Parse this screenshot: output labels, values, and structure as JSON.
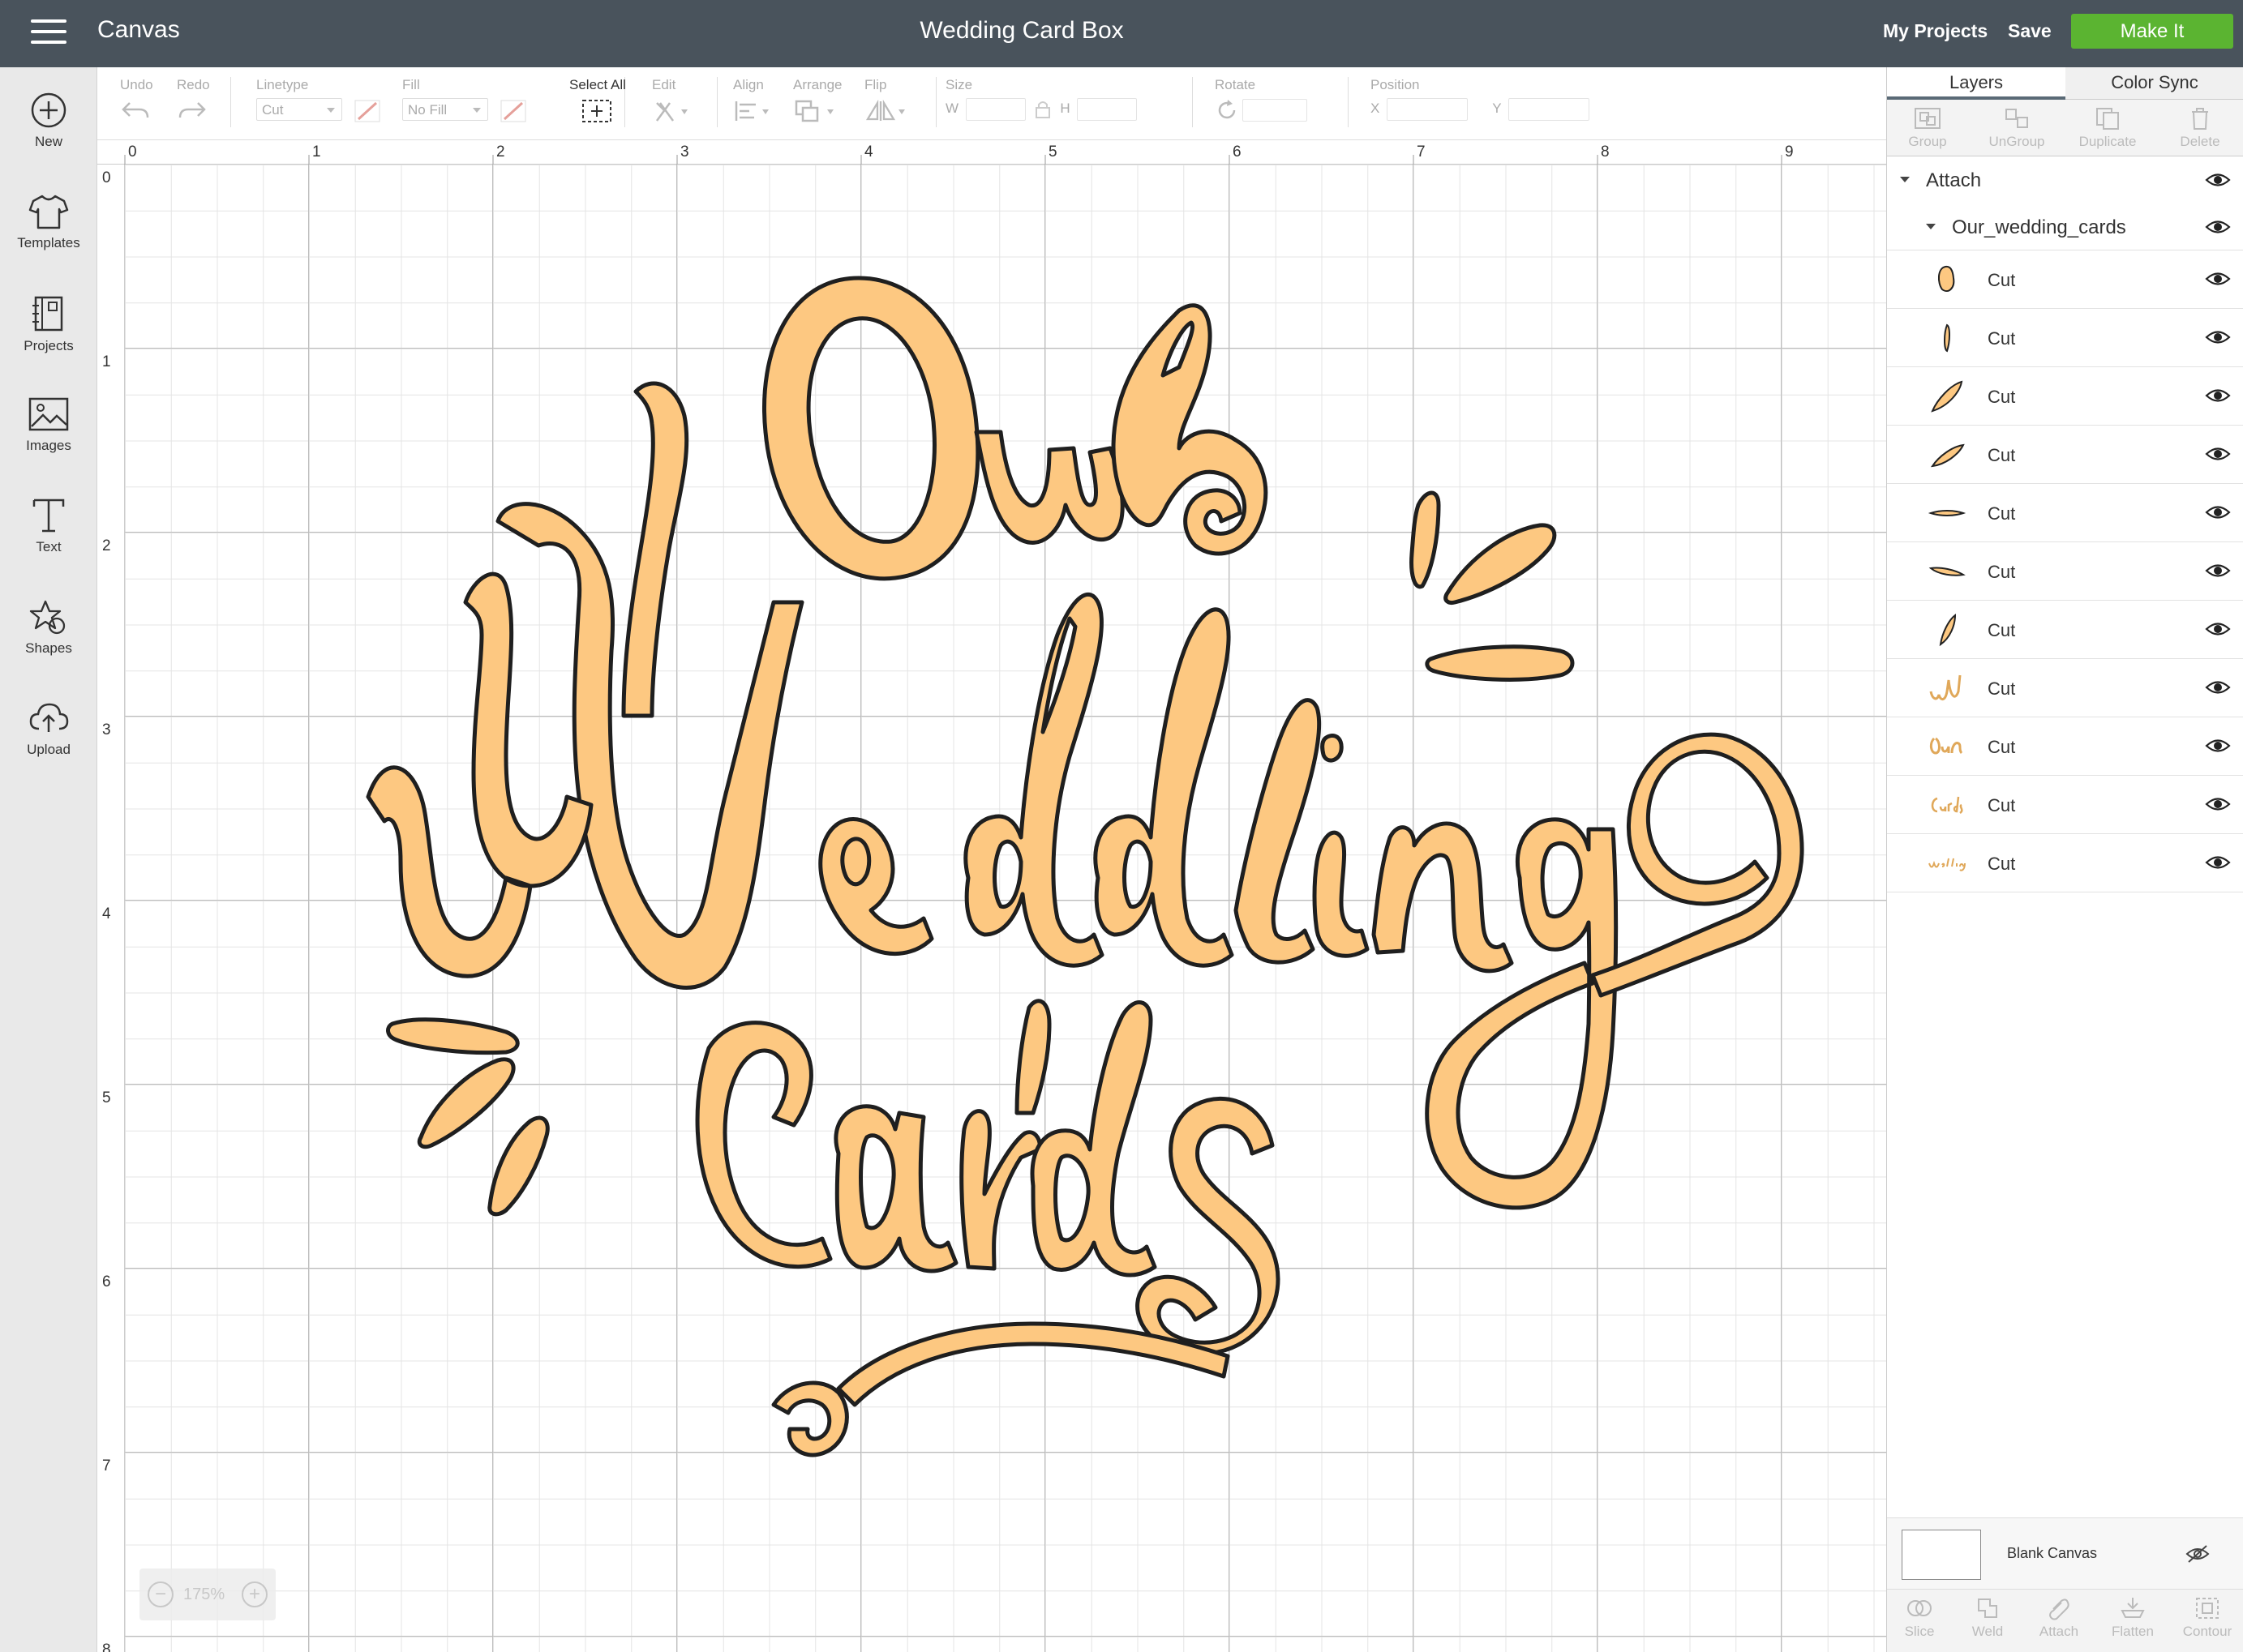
{
  "app": {
    "menu_icon": "hamburger-icon",
    "title": "Canvas",
    "document_title": "Wedding Card Box"
  },
  "header": {
    "my_projects": "My Projects",
    "save": "Save",
    "make_it": "Make It",
    "make_it_color": "#5bb431",
    "bar_color": "#49535c"
  },
  "sidebar": {
    "items": [
      {
        "label": "New",
        "icon": "plus-circle-icon"
      },
      {
        "label": "Templates",
        "icon": "tshirt-icon"
      },
      {
        "label": "Projects",
        "icon": "notebook-icon"
      },
      {
        "label": "Images",
        "icon": "image-icon"
      },
      {
        "label": "Text",
        "icon": "text-t-icon"
      },
      {
        "label": "Shapes",
        "icon": "shapes-icon"
      },
      {
        "label": "Upload",
        "icon": "cloud-upload-icon"
      }
    ]
  },
  "toolbar": {
    "undo": "Undo",
    "redo": "Redo",
    "linetype_label": "Linetype",
    "linetype_value": "Cut",
    "fill_label": "Fill",
    "fill_value": "No Fill",
    "select_all": "Select All",
    "edit": "Edit",
    "align": "Align",
    "arrange": "Arrange",
    "flip": "Flip",
    "size": "Size",
    "size_w": "W",
    "size_h": "H",
    "rotate": "Rotate",
    "position": "Position",
    "pos_x": "X",
    "pos_y": "Y"
  },
  "rulers": {
    "horizontal": [
      "0",
      "1",
      "2",
      "3",
      "4",
      "5",
      "6",
      "7",
      "8",
      "9"
    ],
    "vertical": [
      "0",
      "1",
      "2",
      "3",
      "4",
      "5",
      "6",
      "7",
      "8"
    ]
  },
  "canvas": {
    "zoom_minus": "−",
    "zoom_level": "175%",
    "zoom_plus": "+",
    "fill_color": "#fdc881",
    "stroke_color": "#1f1f1f"
  },
  "panel": {
    "tabs": [
      "Layers",
      "Color Sync"
    ],
    "actions": [
      "Group",
      "UnGroup",
      "Duplicate",
      "Delete"
    ],
    "group_name": "Attach",
    "subgroup_name": "Our_wedding_cards",
    "layers": [
      "Cut",
      "Cut",
      "Cut",
      "Cut",
      "Cut",
      "Cut",
      "Cut",
      "Cut",
      "Cut",
      "Cut",
      "Cut"
    ],
    "blank_canvas": "Blank Canvas",
    "bottom_actions": [
      "Slice",
      "Weld",
      "Attach",
      "Flatten",
      "Contour"
    ]
  }
}
